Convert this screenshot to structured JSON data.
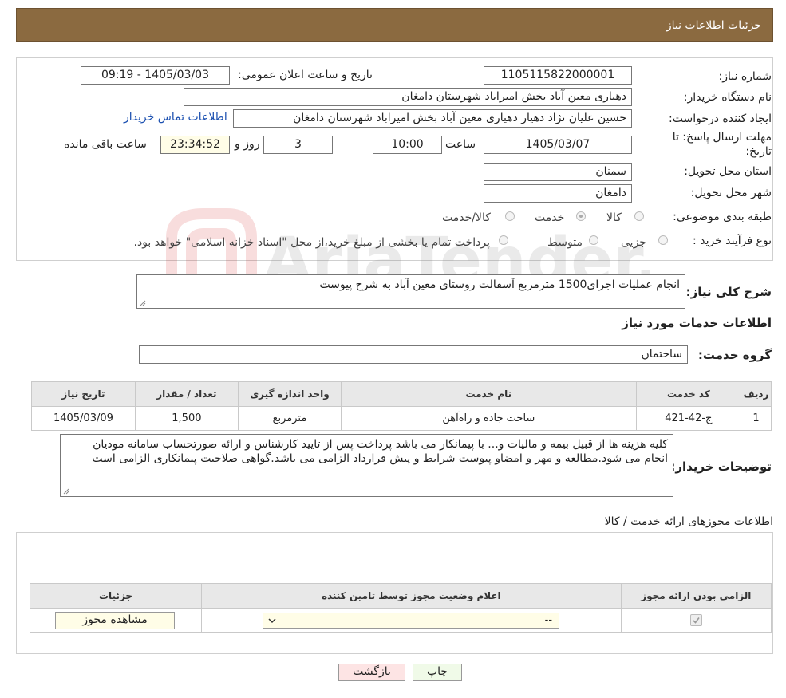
{
  "header": {
    "title": "جزئیات اطلاعات نیاز"
  },
  "form": {
    "need_number_label": "شماره نیاز:",
    "need_number": "1105115822000001",
    "announce_label": "تاریخ و ساعت اعلان عمومی:",
    "announce_value": "1405/03/03 - 09:19",
    "buyer_org_label": "نام دستگاه خریدار:",
    "buyer_org": "دهیاری معین آباد بخش امیراباد شهرستان دامغان",
    "creator_label": "ایجاد کننده درخواست:",
    "creator": "حسین علیان نژاد دهیار دهیاری معین آباد بخش امیراباد شهرستان دامغان",
    "contact_link": "اطلاعات تماس خریدار",
    "deadline_label_1": "مهلت ارسال پاسخ: تا",
    "deadline_label_2": "تاریخ:",
    "deadline_date": "1405/03/07",
    "time_label": "ساعت",
    "deadline_time": "10:00",
    "days_value": "3",
    "days_label": "روز و",
    "remaining_time": "23:34:52",
    "remaining_label": "ساعت باقی مانده",
    "province_label": "استان محل تحویل:",
    "province": "سمنان",
    "city_label": "شهر محل تحویل:",
    "city": "دامغان",
    "category_label": "طبقه بندی موضوعی:",
    "category_options": [
      "کالا",
      "خدمت",
      "کالا/خدمت"
    ],
    "category_selected": "خدمت",
    "process_label": "نوع فرآیند خرید :",
    "process_options": [
      "جزیی",
      "متوسط"
    ],
    "process_note": "پرداخت تمام یا بخشی از مبلغ خرید،از محل \"اسناد خزانه اسلامی\" خواهد بود.",
    "description_label": "شرح کلی نیاز:",
    "description": "انجام عملیات اجرای1500 مترمربع آسفالت روستای معین آباد به شرح پیوست"
  },
  "services": {
    "section_title": "اطلاعات خدمات مورد نیاز",
    "group_label": "گروه خدمت:",
    "group_value": "ساختمان",
    "table_headers": [
      "ردیف",
      "کد خدمت",
      "نام خدمت",
      "واحد اندازه گیری",
      "تعداد / مقدار",
      "تاریخ نیاز"
    ],
    "rows": [
      [
        "1",
        "ج-42-421",
        "ساخت جاده و راه‌آهن",
        "مترمربع",
        "1,500",
        "1405/03/09"
      ]
    ],
    "buyer_notes_label": "توضیحات خریدار:",
    "buyer_notes": "کلیه هزینه ها از قبیل بیمه و مالیات و... با پیمانکار می باشد پرداخت پس از تایید کارشناس و ارائه صورتحساب سامانه مودیان انجام می شود.مطالعه و مهر و امضاو پیوست شرایط و پیش قرارداد الزامی می باشد.گواهی صلاحیت پیمانکاری الزامی است"
  },
  "permits": {
    "section_title": "اطلاعات مجوزهای ارائه خدمت / کالا",
    "table_headers": [
      "الزامی بودن ارائه مجوز",
      "اعلام وضعیت مجوز توسط تامین کننده",
      "جزئیات"
    ],
    "select_value": "--",
    "view_button": "مشاهده مجوز"
  },
  "footer": {
    "print_button": "چاپ",
    "back_button": "بازگشت"
  },
  "watermark_text": "AriaTender.neT",
  "colors": {
    "header_bg": "#8B6A40",
    "print_bg": "#f0fae8",
    "back_bg": "#fde4e4",
    "link": "#1a4fb0"
  }
}
